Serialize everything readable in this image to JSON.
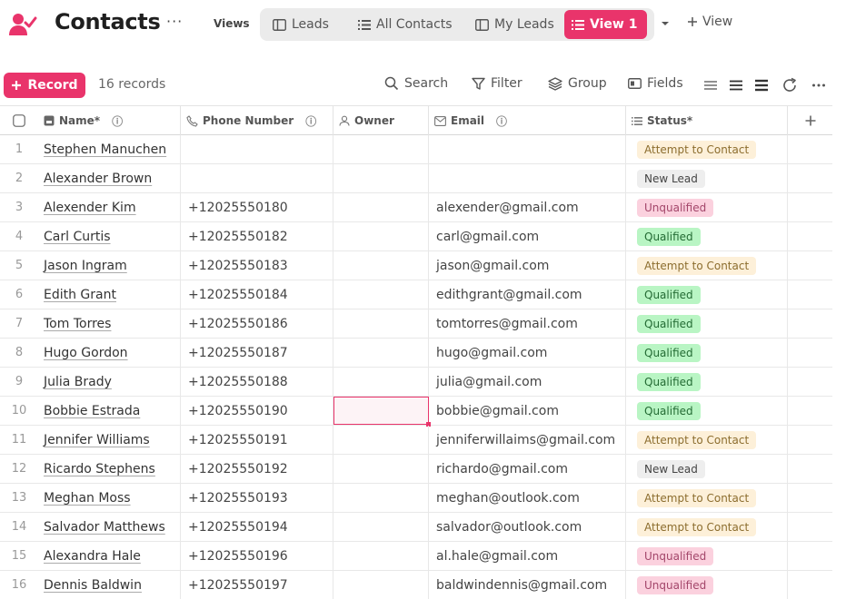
{
  "app": {
    "title": "Contacts",
    "brand_color": "#e9346b",
    "icon": "contacts-user-check-icon"
  },
  "views": {
    "label": "Views",
    "tabs": [
      {
        "label": "Leads",
        "icon": "kanban-icon"
      },
      {
        "label": "All Contacts",
        "icon": "list-icon"
      },
      {
        "label": "My Leads",
        "icon": "kanban-icon"
      },
      {
        "label": "View 1",
        "icon": "list-icon",
        "active": true
      }
    ],
    "add_label": "View"
  },
  "toolbar": {
    "record_label": "Record",
    "record_count": "16 records",
    "search_label": "Search",
    "filter_label": "Filter",
    "group_label": "Group",
    "fields_label": "Fields"
  },
  "columns": [
    {
      "label": "Name*",
      "icon": "text-field-icon"
    },
    {
      "label": "Phone Number",
      "icon": "phone-icon"
    },
    {
      "label": "Owner",
      "icon": "user-icon"
    },
    {
      "label": "Email",
      "icon": "mail-icon"
    },
    {
      "label": "Status*",
      "icon": "list-icon"
    }
  ],
  "rows": [
    {
      "num": "1",
      "name": "Stephen Manuchen",
      "phone": "",
      "owner": "",
      "email": "",
      "status": "Attempt to Contact",
      "status_type": "attempt"
    },
    {
      "num": "2",
      "name": "Alexander Brown",
      "phone": "",
      "owner": "",
      "email": "",
      "status": "New Lead",
      "status_type": "new"
    },
    {
      "num": "3",
      "name": "Alexender Kim",
      "phone": "+12025550180",
      "owner": "",
      "email": "alexender@gmail.com",
      "status": "Unqualified",
      "status_type": "unq"
    },
    {
      "num": "4",
      "name": "Carl Curtis",
      "phone": "+12025550182",
      "owner": "",
      "email": "carl@gmail.com",
      "status": "Qualified",
      "status_type": "qual"
    },
    {
      "num": "5",
      "name": "Jason Ingram",
      "phone": "+12025550183",
      "owner": "",
      "email": "jason@gmail.com",
      "status": "Attempt to Contact",
      "status_type": "attempt"
    },
    {
      "num": "6",
      "name": "Edith Grant",
      "phone": "+12025550184",
      "owner": "",
      "email": "edithgrant@gmail.com",
      "status": "Qualified",
      "status_type": "qual"
    },
    {
      "num": "7",
      "name": "Tom Torres",
      "phone": "+12025550186",
      "owner": "",
      "email": "tomtorres@gmail.com",
      "status": "Qualified",
      "status_type": "qual"
    },
    {
      "num": "8",
      "name": "Hugo Gordon",
      "phone": "+12025550187",
      "owner": "",
      "email": "hugo@gmail.com",
      "status": "Qualified",
      "status_type": "qual"
    },
    {
      "num": "9",
      "name": "Julia Brady",
      "phone": "+12025550188",
      "owner": "",
      "email": "julia@gmail.com",
      "status": "Qualified",
      "status_type": "qual"
    },
    {
      "num": "10",
      "name": "Bobbie Estrada",
      "phone": "+12025550190",
      "owner": "",
      "email": "bobbie@gmail.com",
      "status": "Qualified",
      "status_type": "qual",
      "owner_selected": true
    },
    {
      "num": "11",
      "name": "Jennifer Williams",
      "phone": "+12025550191",
      "owner": "",
      "email": "jenniferwillaims@gmail.com",
      "status": "Attempt to Contact",
      "status_type": "attempt"
    },
    {
      "num": "12",
      "name": "Ricardo Stephens",
      "phone": "+12025550192",
      "owner": "",
      "email": "richardo@gmail.com",
      "status": "New Lead",
      "status_type": "new"
    },
    {
      "num": "13",
      "name": "Meghan Moss",
      "phone": "+12025550193",
      "owner": "",
      "email": "meghan@outlook.com",
      "status": "Attempt to Contact",
      "status_type": "attempt"
    },
    {
      "num": "14",
      "name": "Salvador Matthews",
      "phone": "+12025550194",
      "owner": "",
      "email": "salvador@outlook.com",
      "status": "Attempt to Contact",
      "status_type": "attempt"
    },
    {
      "num": "15",
      "name": "Alexandra Hale",
      "phone": "+12025550196",
      "owner": "",
      "email": "al.hale@gmail.com",
      "status": "Unqualified",
      "status_type": "unq"
    },
    {
      "num": "16",
      "name": "Dennis Baldwin",
      "phone": "+12025550197",
      "owner": "",
      "email": "baldwindennis@gmail.com",
      "status": "Unqualified",
      "status_type": "unq"
    }
  ]
}
